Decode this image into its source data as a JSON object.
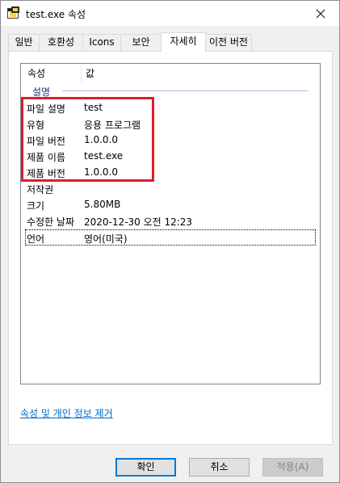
{
  "window": {
    "title": "test.exe 속성"
  },
  "tabs": [
    {
      "label": "일반"
    },
    {
      "label": "호환성"
    },
    {
      "label": "Icons"
    },
    {
      "label": "보안"
    },
    {
      "label": "자세히"
    },
    {
      "label": "이전 버전"
    }
  ],
  "active_tab": "자세히",
  "list": {
    "columns": {
      "property": "속성",
      "value": "값"
    },
    "group": "설명",
    "rows": [
      {
        "key": "파일 설명",
        "value": "test"
      },
      {
        "key": "유형",
        "value": "응용 프로그램"
      },
      {
        "key": "파일 버전",
        "value": "1.0.0.0"
      },
      {
        "key": "제품 이름",
        "value": "test.exe"
      },
      {
        "key": "제품 버전",
        "value": "1.0.0.0"
      },
      {
        "key": "저작권",
        "value": ""
      },
      {
        "key": "크기",
        "value": "5.80MB"
      },
      {
        "key": "수정한 날짜",
        "value": "2020-12-30 오전 12:23"
      },
      {
        "key": "언어",
        "value": "영어(미국)"
      }
    ]
  },
  "link": {
    "remove": "속성 및 개인 정보 제거"
  },
  "buttons": {
    "ok": "확인",
    "cancel": "취소",
    "apply": "적용(A)"
  },
  "colors": {
    "highlight": "#d9202b",
    "link": "#0066cc",
    "group_label": "#1e3287",
    "default_button_border": "#0078d7"
  }
}
